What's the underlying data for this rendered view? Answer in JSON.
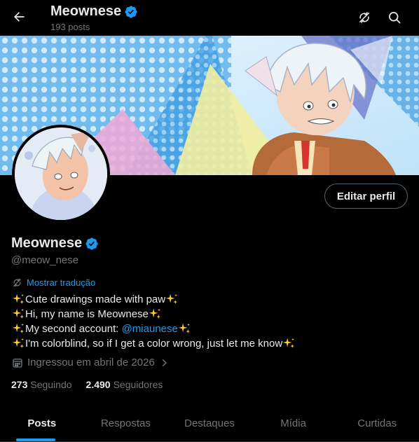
{
  "header": {
    "name": "Meownese",
    "post_count": "193 posts"
  },
  "profile": {
    "display_name": "Meownese",
    "handle": "@meow_nese",
    "edit_button": "Editar perfil",
    "translate_label": "Mostrar tradução",
    "bio": {
      "line1": "Cute drawings made with paw",
      "line2": "Hi, my name is Meownese",
      "line3_prefix": "My second account: ",
      "line3_link": "@miaunese",
      "line4": "I'm colorblind, so if I get a color wrong, just let me know"
    },
    "joined": "Ingressou em abril de 2026",
    "following_count": "273",
    "following_label": "Seguindo",
    "followers_count": "2.490",
    "followers_label": "Seguidores"
  },
  "tabs": [
    {
      "label": "Posts",
      "active": true
    },
    {
      "label": "Respostas",
      "active": false
    },
    {
      "label": "Destaques",
      "active": false
    },
    {
      "label": "Mídia",
      "active": false
    },
    {
      "label": "Curtidas",
      "active": false
    }
  ],
  "colors": {
    "accent": "#1d9bf0",
    "background": "#000000",
    "text": "#e7e9ea",
    "muted": "#71767b"
  },
  "icons": {
    "back": "arrow-left-icon",
    "sync": "sync-off-icon",
    "search": "search-icon",
    "verified": "verified-badge-icon",
    "translate": "translate-icon",
    "calendar": "calendar-icon",
    "sparkle": "sparkle-icon"
  }
}
